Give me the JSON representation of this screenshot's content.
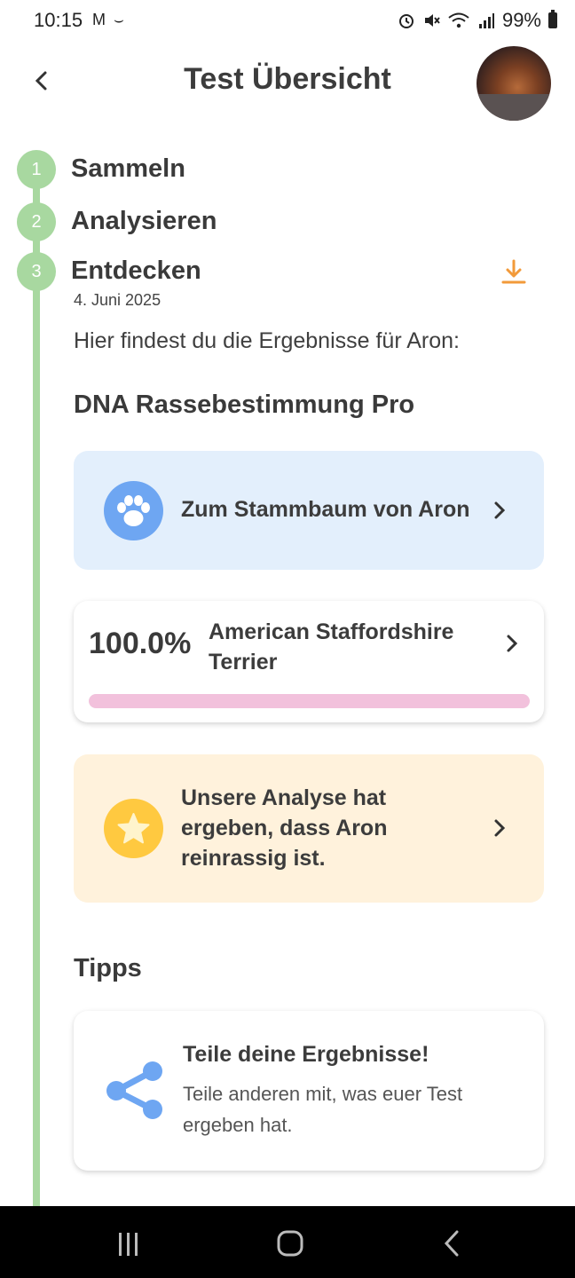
{
  "status_bar": {
    "time": "10:15",
    "notification_icons": "M ⌣",
    "battery": "99%"
  },
  "header": {
    "title": "Test Übersicht",
    "back_icon": "chevron-left-icon"
  },
  "timeline": {
    "steps": [
      {
        "number": "1",
        "label": "Sammeln"
      },
      {
        "number": "2",
        "label": "Analysieren"
      },
      {
        "number": "3",
        "label": "Entdecken"
      }
    ],
    "date": "4. Juni 2025"
  },
  "results": {
    "intro": "Hier findest du die Ergebnisse für Aron:",
    "section_title": "DNA Rassebestimmung Pro",
    "pedigree_link": "Zum Stammbaum von Aron",
    "breed": {
      "percent": "100.0%",
      "name": "American Staffordshire Terrier",
      "share": 1.0,
      "bar_color": "#f2c1dc"
    },
    "purebred_text": "Unsere Analyse hat ergeben, dass Aron reinrassig ist."
  },
  "tips": {
    "title": "Tipps",
    "share_title": "Teile deine Ergebnisse!",
    "share_desc": "Teile anderen mit, was euer Test ergeben hat."
  },
  "colors": {
    "timeline": "#a8d8a0",
    "download": "#f29a3a",
    "paw": "#6ea6f2",
    "star": "#ffc940",
    "share": "#6ea6f2"
  }
}
